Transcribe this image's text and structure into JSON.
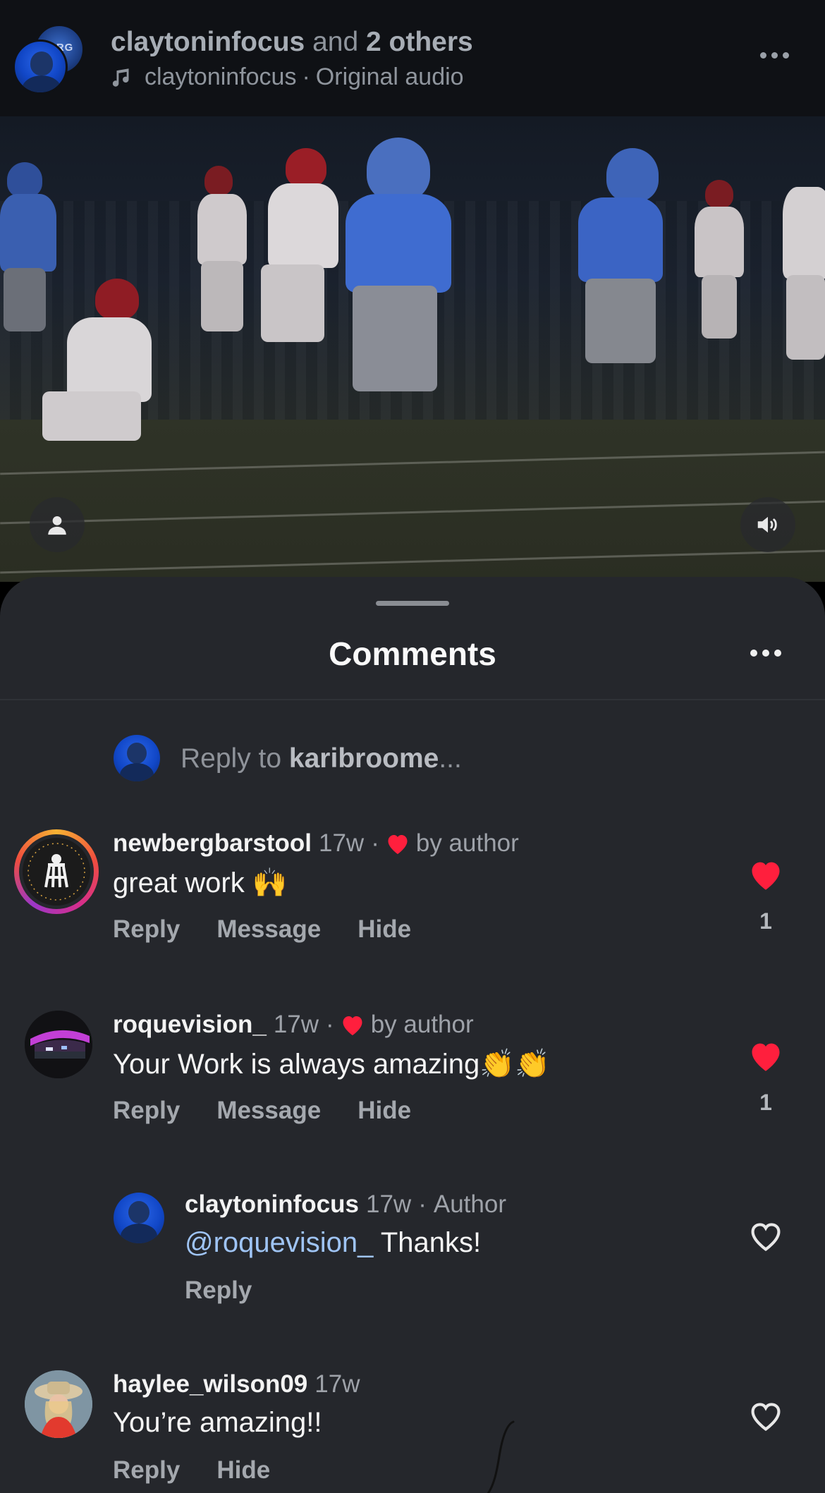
{
  "header": {
    "owner": "claytoninfocus",
    "and_text": "and",
    "others": "2 others",
    "audio_user": "claytoninfocus",
    "audio_sep": "·",
    "audio_label": "Original audio",
    "avatar_back_text": "BERG"
  },
  "sheet": {
    "title": "Comments",
    "reply_prefix": "Reply to",
    "reply_user": "karibroome",
    "reply_suffix": "..."
  },
  "comments": [
    {
      "username": "newbergbarstool",
      "time": "17w",
      "sep": "·",
      "liked_by": "by author",
      "text": "great work 🙌",
      "actions": [
        "Reply",
        "Message",
        "Hide"
      ],
      "likes": "1",
      "liked": true
    },
    {
      "username": "roquevision_",
      "time": "17w",
      "sep": "·",
      "liked_by": "by author",
      "text": "Your Work is always amazing👏👏",
      "actions": [
        "Reply",
        "Message",
        "Hide"
      ],
      "likes": "1",
      "liked": true
    },
    {
      "username": "claytoninfocus",
      "time": "17w",
      "sep": "·",
      "badge": "Author",
      "mention": "@roquevision_",
      "text": " Thanks!",
      "actions": [
        "Reply"
      ],
      "liked": false
    },
    {
      "username": "haylee_wilson09",
      "time": "17w",
      "text": "You’re amazing!!",
      "actions": [
        "Reply",
        "Hide"
      ],
      "liked": false
    }
  ],
  "colors": {
    "sheet_bg": "#25272c",
    "heart_red": "#ff1f3d",
    "mention_blue": "#9fc4f5"
  },
  "icons": [
    "music-note-icon",
    "more-icon",
    "person-icon",
    "speaker-muted-icon",
    "heart-icon"
  ]
}
